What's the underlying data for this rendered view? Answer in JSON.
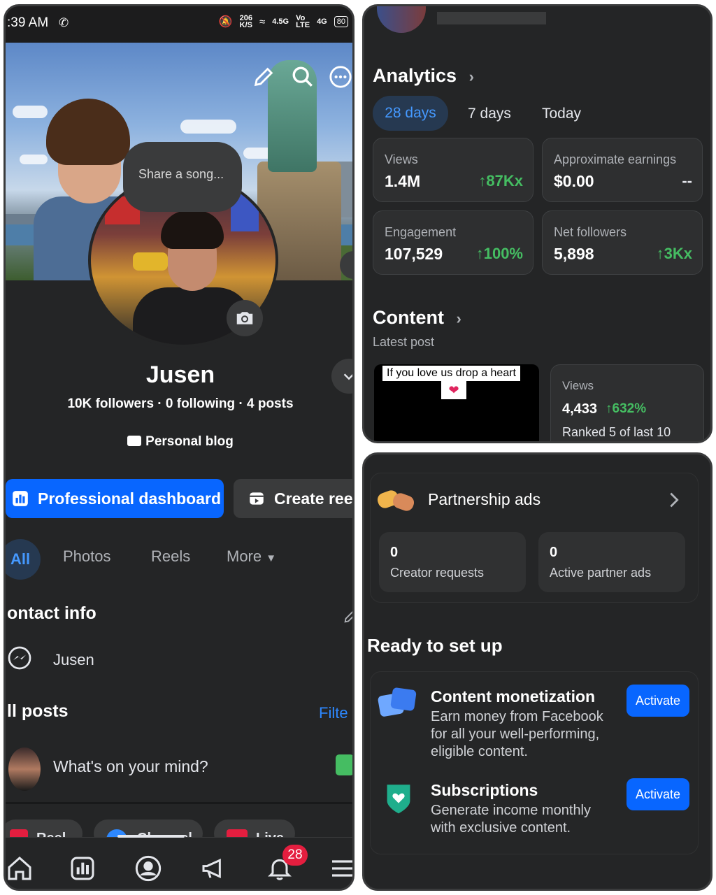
{
  "status_bar": {
    "time": ":39 AM",
    "net_speed": "206\nK/S",
    "signal_1": "4.5G",
    "volte": "Vo\nLTE",
    "signal_2": "4G",
    "battery": "80"
  },
  "profile": {
    "song_prompt": "Share a song...",
    "name": "Jusen",
    "stats": "10K followers · 0 following · 4 posts",
    "category": "Personal blog",
    "primary_button": "Professional dashboard",
    "secondary_button": "Create reel",
    "tabs": {
      "all": "All",
      "photos": "Photos",
      "reels": "Reels",
      "more": "More"
    },
    "contact_title": "ontact info",
    "messenger_name": "Jusen",
    "posts_title": "ll posts",
    "filter": "Filte",
    "composer_placeholder": "What's on your mind?",
    "chips": [
      "Reel",
      "Channel",
      "Live"
    ],
    "notification_count": "28"
  },
  "analytics": {
    "title": "Analytics",
    "ranges": [
      "28 days",
      "7 days",
      "Today"
    ],
    "cards": [
      {
        "label": "Views",
        "value": "1.4M",
        "delta": "87Kx"
      },
      {
        "label": "Approximate earnings",
        "value": "$0.00",
        "delta": "--"
      },
      {
        "label": "Engagement",
        "value": "107,529",
        "delta": "100%"
      },
      {
        "label": "Net followers",
        "value": "5,898",
        "delta": "3Kx"
      }
    ],
    "content_title": "Content",
    "latest_post_label": "Latest post",
    "thumb_caption": "If you love us drop a heart",
    "post_views_label": "Views",
    "post_views_value": "4,433",
    "post_views_delta": "632%",
    "post_rank": "Ranked 5 of last 10"
  },
  "partnership": {
    "title": "Partnership ads",
    "creator_requests_count": "0",
    "creator_requests_label": "Creator requests",
    "active_ads_count": "0",
    "active_ads_label": "Active partner ads"
  },
  "setup": {
    "title": "Ready to set up",
    "items": [
      {
        "title": "Content monetization",
        "desc": "Earn money from Facebook for all your well-performing, eligible content.",
        "button": "Activate"
      },
      {
        "title": "Subscriptions",
        "desc": "Generate income monthly with exclusive content.",
        "button": "Activate"
      }
    ]
  },
  "colors": {
    "background": "#242526",
    "accent": "#0866ff",
    "positive": "#45bd62",
    "tab_active_bg": "#263951",
    "tab_active_fg": "#4599ff",
    "badge": "#e41e3f"
  }
}
